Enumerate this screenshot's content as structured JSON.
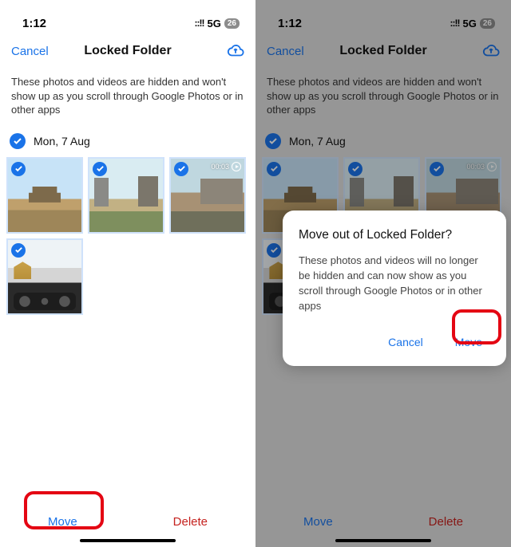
{
  "status": {
    "time": "1:12",
    "signal": "::!!",
    "network": "5G",
    "battery": "26"
  },
  "nav": {
    "cancel": "Cancel",
    "title": "Locked Folder"
  },
  "description": "These photos and videos are hidden and won't show up as you scroll through Google Photos or in other apps",
  "date_section": {
    "label": "Mon, 7 Aug"
  },
  "thumbs": {
    "video_duration": "00:03"
  },
  "bottom": {
    "move": "Move",
    "delete": "Delete"
  },
  "dialog": {
    "title": "Move out of Locked Folder?",
    "body": "These photos and videos will no longer be hidden and can now show as you scroll through Google Photos or in other apps",
    "cancel": "Cancel",
    "move": "Move"
  }
}
